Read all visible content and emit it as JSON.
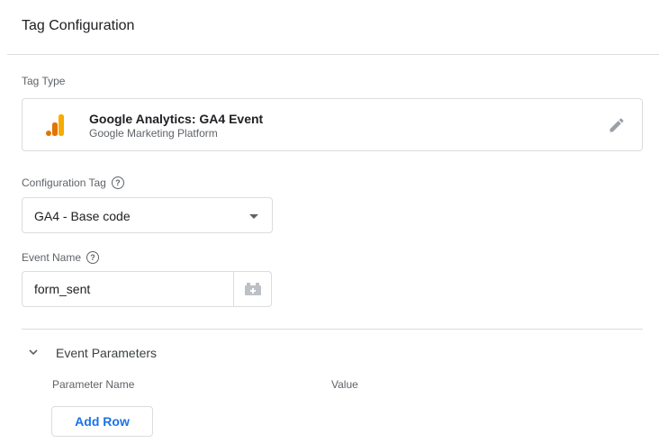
{
  "header": {
    "title": "Tag Configuration"
  },
  "tag_type": {
    "label": "Tag Type",
    "name": "Google Analytics: GA4 Event",
    "platform": "Google Marketing Platform",
    "logo_icon": "google-analytics-logo",
    "edit_icon": "pencil-icon"
  },
  "configuration_tag": {
    "label": "Configuration Tag",
    "help_glyph": "?",
    "value": "GA4 - Base code"
  },
  "event_name": {
    "label": "Event Name",
    "help_glyph": "?",
    "value": "form_sent",
    "variable_icon": "insert-variable-icon"
  },
  "event_parameters": {
    "title": "Event Parameters",
    "expanded": true,
    "columns": [
      "Parameter Name",
      "Value"
    ],
    "add_row_label": "Add Row"
  },
  "colors": {
    "accent": "#1a73e8",
    "ga_orange": "#F9AB00",
    "ga_dark_orange": "#E37400",
    "border": "#dadce0",
    "muted_text": "#5f6368"
  }
}
